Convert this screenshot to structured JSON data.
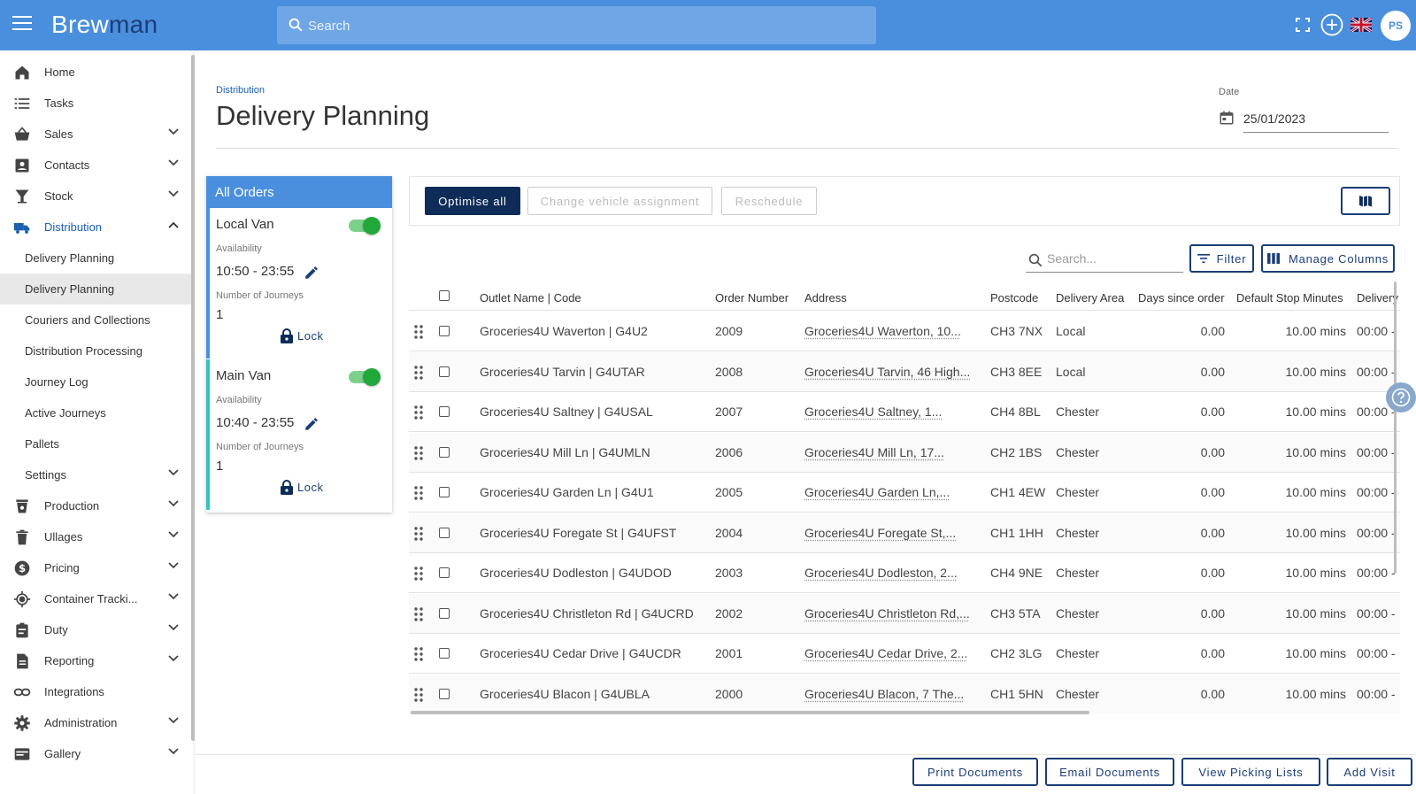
{
  "app": {
    "logo_part1": "Brew",
    "logo_part2": "man",
    "search_placeholder": "Search",
    "user_initials": "PS"
  },
  "sidebar": {
    "items": [
      {
        "label": "Home",
        "icon": "home-icon"
      },
      {
        "label": "Tasks",
        "icon": "tasks-icon"
      },
      {
        "label": "Sales",
        "icon": "basket-icon"
      },
      {
        "label": "Contacts",
        "icon": "contacts-icon"
      },
      {
        "label": "Stock",
        "icon": "glass-icon"
      },
      {
        "label": "Distribution",
        "icon": "truck-icon"
      },
      {
        "label": "Delivery Planning"
      },
      {
        "label": "Delivery Planning"
      },
      {
        "label": "Couriers and Collections"
      },
      {
        "label": "Distribution Processing"
      },
      {
        "label": "Journey Log"
      },
      {
        "label": "Active Journeys"
      },
      {
        "label": "Pallets"
      },
      {
        "label": "Settings"
      },
      {
        "label": "Production",
        "icon": "production-icon"
      },
      {
        "label": "Ullages",
        "icon": "bin-icon"
      },
      {
        "label": "Pricing",
        "icon": "dollar-icon"
      },
      {
        "label": "Container Tracki...",
        "icon": "target-icon"
      },
      {
        "label": "Duty",
        "icon": "clipboard-icon"
      },
      {
        "label": "Reporting",
        "icon": "report-icon"
      },
      {
        "label": "Integrations",
        "icon": "link-icon"
      },
      {
        "label": "Administration",
        "icon": "gear-icon"
      },
      {
        "label": "Gallery",
        "icon": "gallery-icon"
      }
    ]
  },
  "page": {
    "breadcrumb": "Distribution",
    "title": "Delivery Planning",
    "date_label": "Date",
    "date_value": "25/01/2023"
  },
  "vehicles": {
    "header": "All Orders",
    "availability_label": "Availability",
    "journeys_label": "Number of Journeys",
    "lock_label": "Lock",
    "items": [
      {
        "name": "Local Van",
        "availability": "10:50 - 23:55",
        "journeys": "1"
      },
      {
        "name": "Main Van",
        "availability": "10:40 - 23:55",
        "journeys": "1"
      }
    ]
  },
  "toolbar": {
    "optimise_label": "Optimise all",
    "change_vehicle_label": "Change vehicle assignment",
    "reschedule_label": "Reschedule"
  },
  "table": {
    "search_placeholder": "Search...",
    "filter_label": "Filter",
    "manage_columns_label": "Manage Columns",
    "columns": [
      "Outlet Name | Code",
      "Order Number",
      "Address",
      "Postcode",
      "Delivery Area",
      "Days since order",
      "Default Stop Minutes",
      "Delivery"
    ],
    "rows": [
      {
        "outlet": "Groceries4U Waverton | G4U2",
        "order": "2009",
        "address": "Groceries4U Waverton, 10...",
        "postcode": "CH3 7NX",
        "area": "Local",
        "days": "0.00",
        "stop": "10.00 mins",
        "delivery": "00:00 -"
      },
      {
        "outlet": "Groceries4U Tarvin | G4UTAR",
        "order": "2008",
        "address": "Groceries4U Tarvin, 46 High...",
        "postcode": "CH3 8EE",
        "area": "Local",
        "days": "0.00",
        "stop": "10.00 mins",
        "delivery": "00:00 -"
      },
      {
        "outlet": "Groceries4U Saltney | G4USAL",
        "order": "2007",
        "address": "Groceries4U Saltney, 1...",
        "postcode": "CH4 8BL",
        "area": "Chester",
        "days": "0.00",
        "stop": "10.00 mins",
        "delivery": "00:00 -"
      },
      {
        "outlet": "Groceries4U Mill Ln | G4UMLN",
        "order": "2006",
        "address": "Groceries4U Mill Ln, 17...",
        "postcode": "CH2 1BS",
        "area": "Chester",
        "days": "0.00",
        "stop": "10.00 mins",
        "delivery": "00:00 -"
      },
      {
        "outlet": "Groceries4U Garden Ln | G4U1",
        "order": "2005",
        "address": "Groceries4U Garden Ln,...",
        "postcode": "CH1 4EW",
        "area": "Chester",
        "days": "0.00",
        "stop": "10.00 mins",
        "delivery": "00:00 -"
      },
      {
        "outlet": "Groceries4U Foregate St | G4UFST",
        "order": "2004",
        "address": "Groceries4U Foregate St,...",
        "postcode": "CH1 1HH",
        "area": "Chester",
        "days": "0.00",
        "stop": "10.00 mins",
        "delivery": "00:00 -"
      },
      {
        "outlet": "Groceries4U Dodleston | G4UDOD",
        "order": "2003",
        "address": "Groceries4U Dodleston, 2...",
        "postcode": "CH4 9NE",
        "area": "Chester",
        "days": "0.00",
        "stop": "10.00 mins",
        "delivery": "00:00 -"
      },
      {
        "outlet": "Groceries4U Christleton Rd | G4UCRD",
        "order": "2002",
        "address": "Groceries4U Christleton Rd,...",
        "postcode": "CH3 5TA",
        "area": "Chester",
        "days": "0.00",
        "stop": "10.00 mins",
        "delivery": "00:00 -"
      },
      {
        "outlet": "Groceries4U Cedar Drive | G4UCDR",
        "order": "2001",
        "address": "Groceries4U Cedar Drive, 2...",
        "postcode": "CH2 3LG",
        "area": "Chester",
        "days": "0.00",
        "stop": "10.00 mins",
        "delivery": "00:00 -"
      },
      {
        "outlet": "Groceries4U Blacon | G4UBLA",
        "order": "2000",
        "address": "Groceries4U Blacon, 7 The...",
        "postcode": "CH1 5HN",
        "area": "Chester",
        "days": "0.00",
        "stop": "10.00 mins",
        "delivery": "00:00 -"
      }
    ]
  },
  "footer": {
    "print_label": "Print Documents",
    "email_label": "Email Documents",
    "picking_label": "View Picking Lists",
    "add_visit_label": "Add Visit"
  },
  "colors": {
    "brand": "#4a8fdd",
    "navy": "#0f2c59",
    "toggle_on": "#22a83a"
  }
}
